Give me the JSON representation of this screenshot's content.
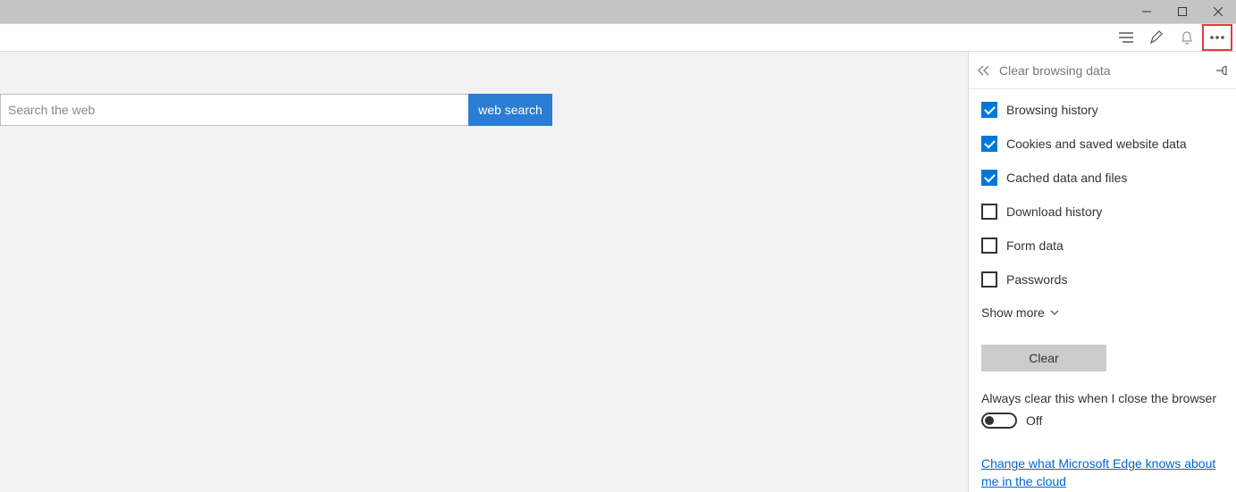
{
  "window": {
    "minimize_icon": "minimize-icon",
    "maximize_icon": "maximize-icon",
    "close_icon": "close-icon"
  },
  "toolbar": {
    "reading_list_icon": "reading-list-icon",
    "notes_icon": "notes-icon",
    "notifications_icon": "notifications-icon",
    "more_icon": "more-icon"
  },
  "search": {
    "placeholder": "Search the web",
    "button_label": "web search"
  },
  "panel": {
    "title": "Clear browsing data",
    "items": [
      {
        "label": "Browsing history",
        "checked": true
      },
      {
        "label": "Cookies and saved website data",
        "checked": true
      },
      {
        "label": "Cached data and files",
        "checked": true
      },
      {
        "label": "Download history",
        "checked": false
      },
      {
        "label": "Form data",
        "checked": false
      },
      {
        "label": "Passwords",
        "checked": false
      }
    ],
    "show_more_label": "Show more",
    "clear_button_label": "Clear",
    "always_clear_label": "Always clear this when I close the browser",
    "toggle_state": "Off",
    "link_text": "Change what Microsoft Edge knows about me in the cloud"
  }
}
